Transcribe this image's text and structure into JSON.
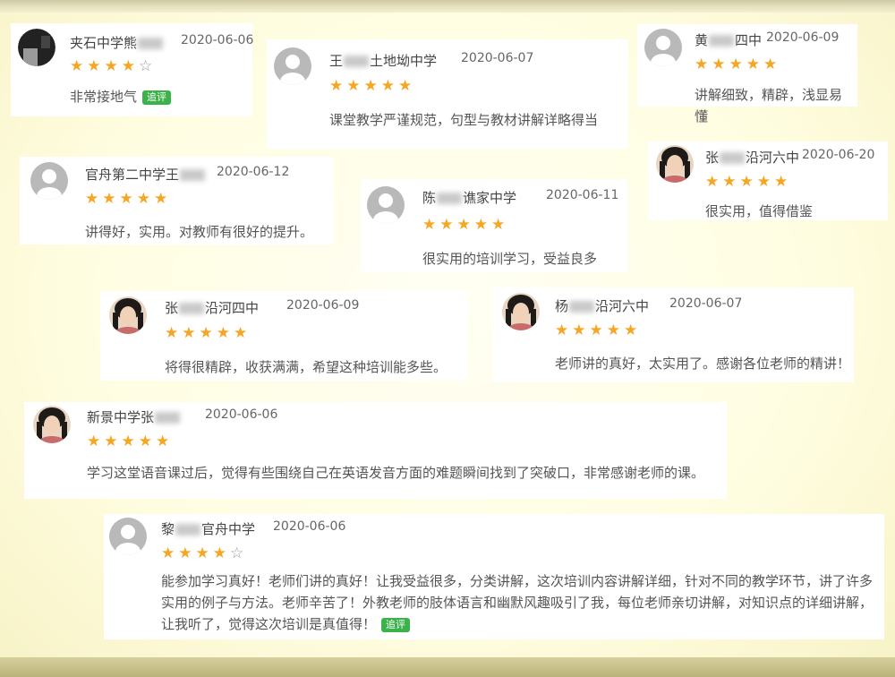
{
  "reviews": [
    {
      "name_prefix": "夹石中学熊",
      "name_suffix": "",
      "date": "2020-06-06",
      "rating": 4,
      "comment": "非常接地气",
      "badge": "追评",
      "avatar": "photo-dark-avatar"
    },
    {
      "name_prefix": "王",
      "name_suffix": "土地坳中学",
      "date": "2020-06-07",
      "rating": 5,
      "comment": "课堂教学严谨规范，句型与教材讲解详略得当",
      "badge": "",
      "avatar": "default-avatar"
    },
    {
      "name_prefix": "黄",
      "name_suffix": "四中",
      "date": "2020-06-09",
      "rating": 5,
      "comment": "讲解细致，精辟，浅显易懂",
      "badge": "",
      "avatar": "default-avatar"
    },
    {
      "name_prefix": "官舟第二中学王",
      "name_suffix": "",
      "date": "2020-06-12",
      "rating": 5,
      "comment": "讲得好，实用。对教师有很好的提升。",
      "badge": "",
      "avatar": "default-avatar"
    },
    {
      "name_prefix": "陈",
      "name_suffix": "谯家中学",
      "date": "2020-06-11",
      "rating": 5,
      "comment": "很实用的培训学习，受益良多",
      "badge": "",
      "avatar": "default-avatar"
    },
    {
      "name_prefix": "张",
      "name_suffix": "沿河六中",
      "date": "2020-06-20",
      "rating": 5,
      "comment": "很实用，值得借鉴",
      "badge": "",
      "avatar": "photo-woman-avatar"
    },
    {
      "name_prefix": "张",
      "name_suffix": "沿河四中",
      "date": "2020-06-09",
      "rating": 5,
      "comment": "将得很精辟，收获满满，希望这种培训能多些。",
      "badge": "",
      "avatar": "photo-woman-avatar"
    },
    {
      "name_prefix": "杨",
      "name_suffix": "沿河六中",
      "date": "2020-06-07",
      "rating": 5,
      "comment": "老师讲的真好，太实用了。感谢各位老师的精讲！",
      "badge": "",
      "avatar": "photo-woman-avatar"
    },
    {
      "name_prefix": "新景中学张",
      "name_suffix": "",
      "date": "2020-06-06",
      "rating": 5,
      "comment": "学习这堂语音课过后，觉得有些围绕自己在英语发音方面的难题瞬间找到了突破口，非常感谢老师的课。",
      "badge": "",
      "avatar": "photo-woman-avatar"
    },
    {
      "name_prefix": "黎",
      "name_suffix": "官舟中学",
      "date": "2020-06-06",
      "rating": 4,
      "comment": "能参加学习真好！老师们讲的真好！让我受益很多，分类讲解，这次培训内容讲解详细，针对不同的教学环节，讲了许多实用的例子与方法。老师辛苦了！外教老师的肢体语言和幽默风趣吸引了我，每位老师亲切讲解，对知识点的详细讲解，让我听了，觉得这次培训是真值得！",
      "badge": "追评",
      "avatar": "default-avatar"
    }
  ],
  "colors": {
    "star": "#f5a623",
    "badge": "#3cb24a"
  }
}
